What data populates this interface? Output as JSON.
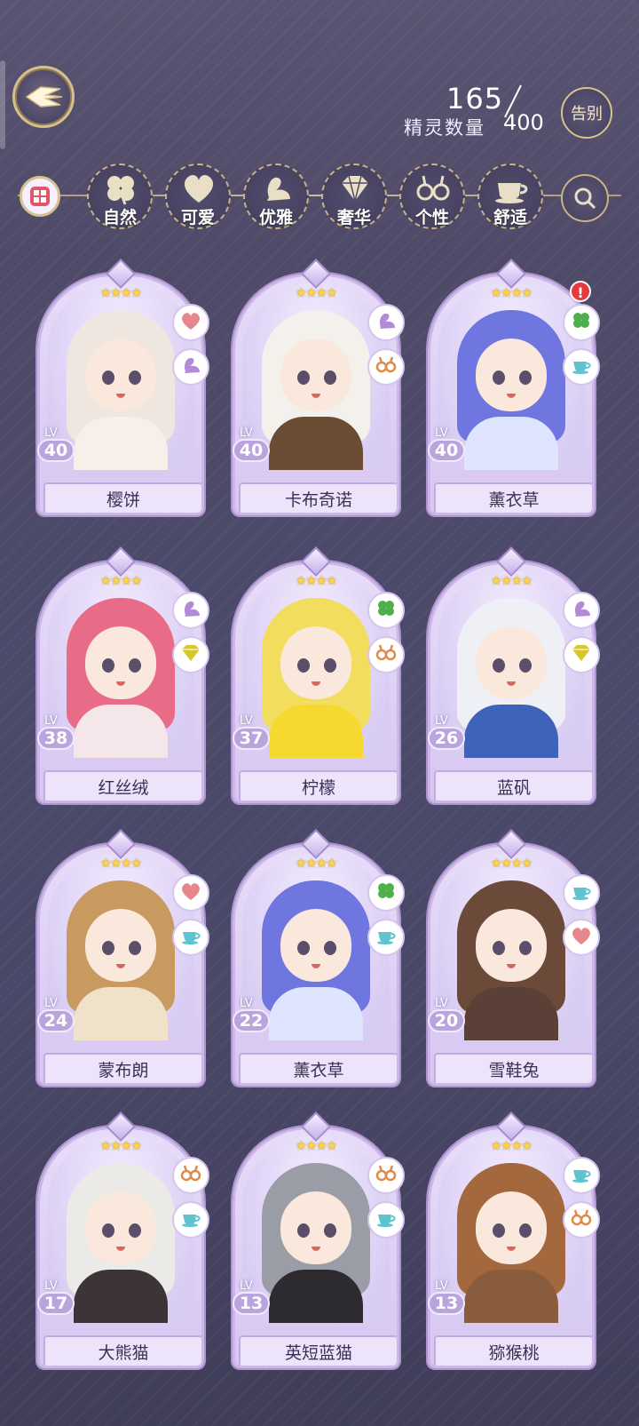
{
  "header": {
    "count_current": "165",
    "count_label": "精灵数量",
    "count_max": "400",
    "farewell_label": "告别"
  },
  "filters": [
    {
      "label": "自然",
      "icon": "clover-icon"
    },
    {
      "label": "可爱",
      "icon": "heart-icon"
    },
    {
      "label": "优雅",
      "icon": "swan-icon"
    },
    {
      "label": "奢华",
      "icon": "diamond-icon"
    },
    {
      "label": "个性",
      "icon": "glasses-icon"
    },
    {
      "label": "舒适",
      "icon": "teacup-icon"
    }
  ],
  "cards": [
    {
      "name": "樱饼",
      "lv_label": "LV",
      "level": "40",
      "stars": "★★★★",
      "traits": [
        "heart-icon",
        "swan-icon"
      ],
      "hair": "#efe6df",
      "outfit": "#f7efe9",
      "alert": false
    },
    {
      "name": "卡布奇诺",
      "lv_label": "LV",
      "level": "40",
      "stars": "★★★★",
      "traits": [
        "swan-icon",
        "glasses-icon"
      ],
      "hair": "#f4f1ec",
      "outfit": "#6b4c34",
      "alert": false
    },
    {
      "name": "薰衣草",
      "lv_label": "LV",
      "level": "40",
      "stars": "★★★★",
      "traits": [
        "clover-icon",
        "teacup-icon"
      ],
      "hair": "#6f76e0",
      "outfit": "#dfe4ff",
      "alert": true
    },
    {
      "name": "红丝绒",
      "lv_label": "LV",
      "level": "38",
      "stars": "★★★★",
      "traits": [
        "swan-icon",
        "diamond-icon"
      ],
      "hair": "#e86b88",
      "outfit": "#f5e6ea",
      "alert": false
    },
    {
      "name": "柠檬",
      "lv_label": "LV",
      "level": "37",
      "stars": "★★★★",
      "traits": [
        "clover-icon",
        "glasses-icon"
      ],
      "hair": "#f2dd5f",
      "outfit": "#f6d92e",
      "alert": false
    },
    {
      "name": "蓝矾",
      "lv_label": "LV",
      "level": "26",
      "stars": "★★★★",
      "traits": [
        "swan-icon",
        "diamond-icon"
      ],
      "hair": "#eef0f6",
      "outfit": "#3f63b8",
      "alert": false
    },
    {
      "name": "蒙布朗",
      "lv_label": "LV",
      "level": "24",
      "stars": "★★★★",
      "traits": [
        "heart-icon",
        "teacup-icon"
      ],
      "hair": "#c89a60",
      "outfit": "#efe2c8",
      "alert": false
    },
    {
      "name": "薰衣草",
      "lv_label": "LV",
      "level": "22",
      "stars": "★★★★",
      "traits": [
        "clover-icon",
        "teacup-icon"
      ],
      "hair": "#6f76e0",
      "outfit": "#dfe4ff",
      "alert": false
    },
    {
      "name": "雪鞋兔",
      "lv_label": "LV",
      "level": "20",
      "stars": "★★★★",
      "traits": [
        "teacup-icon",
        "heart-icon"
      ],
      "hair": "#6c4a3a",
      "outfit": "#5a4036",
      "alert": false
    },
    {
      "name": "大熊猫",
      "lv_label": "LV",
      "level": "17",
      "stars": "★★★★",
      "traits": [
        "glasses-icon",
        "teacup-icon"
      ],
      "hair": "#eceae6",
      "outfit": "#3c3436",
      "alert": false
    },
    {
      "name": "英短蓝猫",
      "lv_label": "LV",
      "level": "13",
      "stars": "★★★★",
      "traits": [
        "glasses-icon",
        "teacup-icon"
      ],
      "hair": "#9a9ca6",
      "outfit": "#2d2a30",
      "alert": false
    },
    {
      "name": "猕猴桃",
      "lv_label": "LV",
      "level": "13",
      "stars": "★★★★",
      "traits": [
        "teacup-icon",
        "glasses-icon"
      ],
      "hair": "#a3683d",
      "outfit": "#8a5c3e",
      "alert": false
    }
  ],
  "colors": {
    "trait_heart": "#e8868e",
    "trait_swan": "#b38ad8",
    "trait_clover": "#4fb04b",
    "trait_diamond": "#d8c72c",
    "trait_glasses": "#e08a4a",
    "trait_teacup": "#5cc3cf"
  }
}
